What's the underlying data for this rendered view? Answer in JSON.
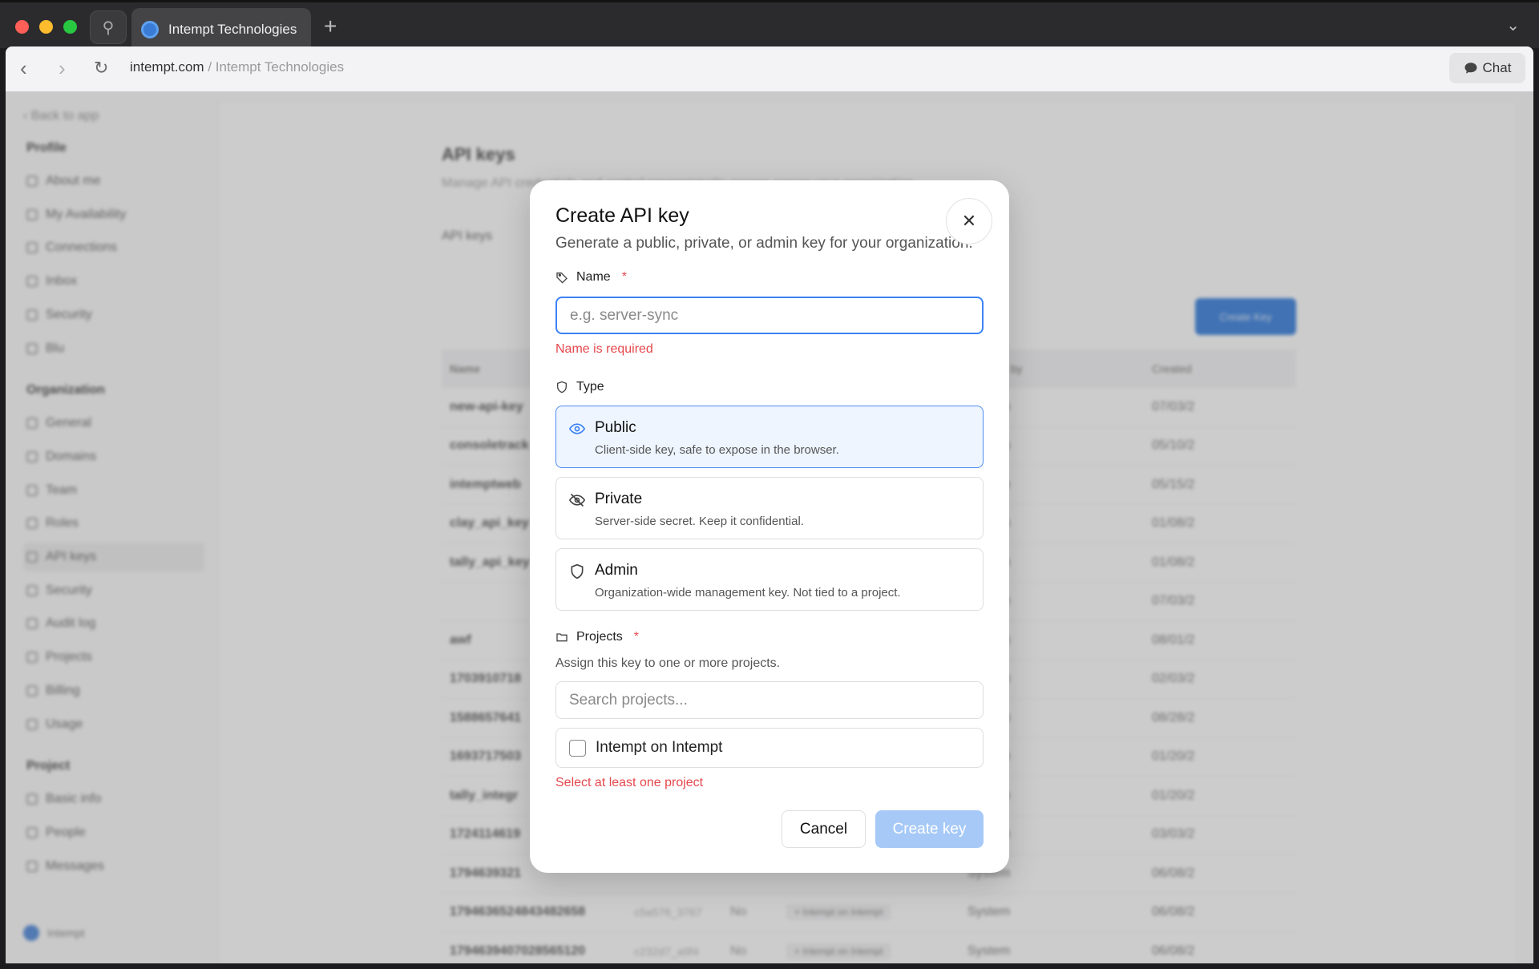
{
  "browser": {
    "tab_title": "Intempt Technologies",
    "url_domain": "intempt.com",
    "url_sep": " / ",
    "url_page": "Intempt Technologies",
    "chat_label": "Chat"
  },
  "sidebar": {
    "back": "Back to app",
    "sections": [
      {
        "title": "Profile",
        "items": [
          "About me",
          "My Availability",
          "Connections",
          "Inbox",
          "Security",
          "Blu"
        ]
      },
      {
        "title": "Organization",
        "items": [
          "General",
          "Domains",
          "Team",
          "Roles",
          "API keys",
          "Security",
          "Audit log",
          "Projects",
          "Billing",
          "Usage"
        ]
      },
      {
        "title": "Project",
        "items": [
          "Basic info",
          "People",
          "Messages"
        ]
      }
    ],
    "active_item": "API keys",
    "footer": "Intempt"
  },
  "main": {
    "title": "API keys",
    "subtitle": "Manage API credentials and control programmatic access across your organization.",
    "section": "API keys",
    "create_button": "Create Key",
    "columns": [
      "Name",
      "",
      "",
      "",
      "Created by",
      "Created"
    ],
    "rows": [
      {
        "name": "new-api-key",
        "creator": "System",
        "created": "07/03/2"
      },
      {
        "name": "consoletrack",
        "creator": "System",
        "created": "05/10/2"
      },
      {
        "name": "intemptweb",
        "creator": "System",
        "created": "05/15/2"
      },
      {
        "name": "clay_api_key",
        "creator": "System",
        "created": "01/08/2"
      },
      {
        "name": "tally_api_key",
        "creator": "System",
        "created": "01/08/2"
      },
      {
        "name": "",
        "creator": "System",
        "created": "07/03/2"
      },
      {
        "name": "awf",
        "creator": "System",
        "created": "08/01/2"
      },
      {
        "name": "1703910718",
        "creator": "System",
        "created": "02/03/2"
      },
      {
        "name": "1588657641",
        "creator": "System",
        "created": "08/28/2"
      },
      {
        "name": "1693717503",
        "creator": "System",
        "created": "01/20/2"
      },
      {
        "name": "tally_integr",
        "creator": "System",
        "created": "01/20/2"
      },
      {
        "name": "1724114619",
        "creator": "System",
        "created": "03/03/2"
      },
      {
        "name": "1794639321",
        "creator": "System",
        "created": "06/08/2"
      },
      {
        "name": "1794636524843482658",
        "key": "c5a576_3767",
        "flag": "No",
        "project": "+ Intempt on Intempt",
        "creator": "System",
        "created": "06/08/2"
      },
      {
        "name": "1794639407028565120",
        "key": "c232d7_a9f4",
        "flag": "No",
        "project": "+ Intempt on Intempt",
        "creator": "System",
        "created": "06/08/2"
      }
    ]
  },
  "modal": {
    "title": "Create API key",
    "description": "Generate a public, private, or admin key for your organization.",
    "name_label": "Name",
    "required_mark": "*",
    "name_placeholder": "e.g. server-sync",
    "name_error": "Name is required",
    "type_label": "Type",
    "types": [
      {
        "title": "Public",
        "desc": "Client-side key, safe to expose in the browser.",
        "icon": "eye-icon",
        "selected": true
      },
      {
        "title": "Private",
        "desc": "Server-side secret. Keep it confidential.",
        "icon": "eye-off-icon",
        "selected": false
      },
      {
        "title": "Admin",
        "desc": "Organization-wide management key. Not tied to a project.",
        "icon": "shield-icon",
        "selected": false
      }
    ],
    "projects_label": "Projects",
    "projects_hint": "Assign this key to one or more projects.",
    "projects_search_placeholder": "Search projects...",
    "project_option": "Intempt on Intempt",
    "projects_error": "Select at least one project",
    "cancel_label": "Cancel",
    "create_label": "Create key"
  },
  "colors": {
    "accent": "#3b82f6",
    "error": "#e5484d",
    "create_disabled": "#a6c9f7",
    "selected_bg": "#eef5ff"
  }
}
